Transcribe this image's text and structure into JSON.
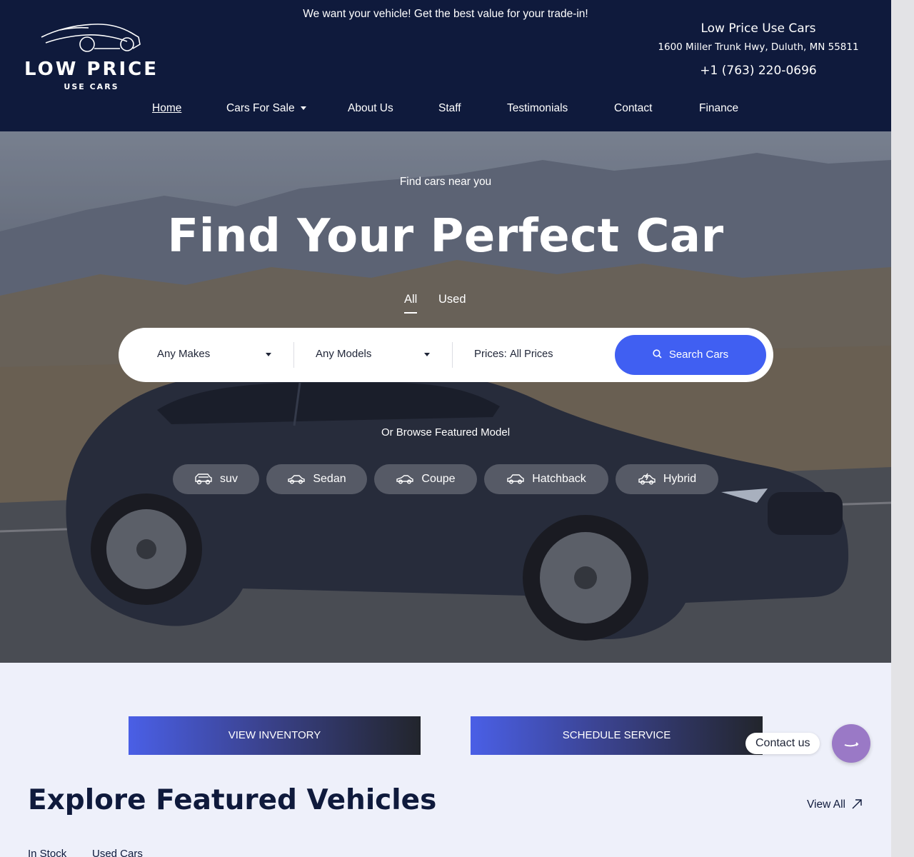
{
  "header": {
    "logo": {
      "line1": "LOW PRICE",
      "line2": "USE CARS"
    },
    "promo_text": "We want your vehicle! Get the best value for your trade-in!",
    "business_name": "Low Price Use Cars",
    "address": "1600 Miller Trunk Hwy, Duluth, MN 55811",
    "phone": "+1 (763) 220-0696"
  },
  "nav": {
    "items": [
      {
        "label": "Home",
        "active": true
      },
      {
        "label": "Cars For Sale",
        "dropdown": true
      },
      {
        "label": "About Us"
      },
      {
        "label": "Staff"
      },
      {
        "label": "Testimonials"
      },
      {
        "label": "Contact"
      },
      {
        "label": "Finance"
      }
    ]
  },
  "hero": {
    "eyebrow": "Find cars near you",
    "headline": "Find Your Perfect Car",
    "tabs": [
      {
        "label": "All",
        "active": true
      },
      {
        "label": "Used"
      }
    ],
    "search": {
      "makes_value": "Any Makes",
      "models_value": "Any Models",
      "prices_label": "Prices:",
      "prices_value": "All Prices",
      "button_label": "Search Cars"
    },
    "browse_label": "Or Browse Featured Model",
    "body_types": [
      {
        "label": "suv",
        "icon": "suv-icon"
      },
      {
        "label": "Sedan",
        "icon": "sedan-icon"
      },
      {
        "label": "Coupe",
        "icon": "coupe-icon"
      },
      {
        "label": "Hatchback",
        "icon": "hatchback-icon"
      },
      {
        "label": "Hybrid",
        "icon": "hybrid-icon"
      }
    ]
  },
  "cta": {
    "inventory_label": "VIEW INVENTORY",
    "service_label": "SCHEDULE SERVICE"
  },
  "featured": {
    "title": "Explore Featured Vehicles",
    "view_all_label": "View All",
    "tabs": [
      {
        "label": "In Stock"
      },
      {
        "label": "Used Cars"
      }
    ]
  },
  "contact_widget": {
    "label": "Contact us"
  },
  "colors": {
    "header_bg": "#0f1a3c",
    "accent": "#405ff2",
    "page_bg": "#eef0fa",
    "fab": "#9a79c6"
  }
}
